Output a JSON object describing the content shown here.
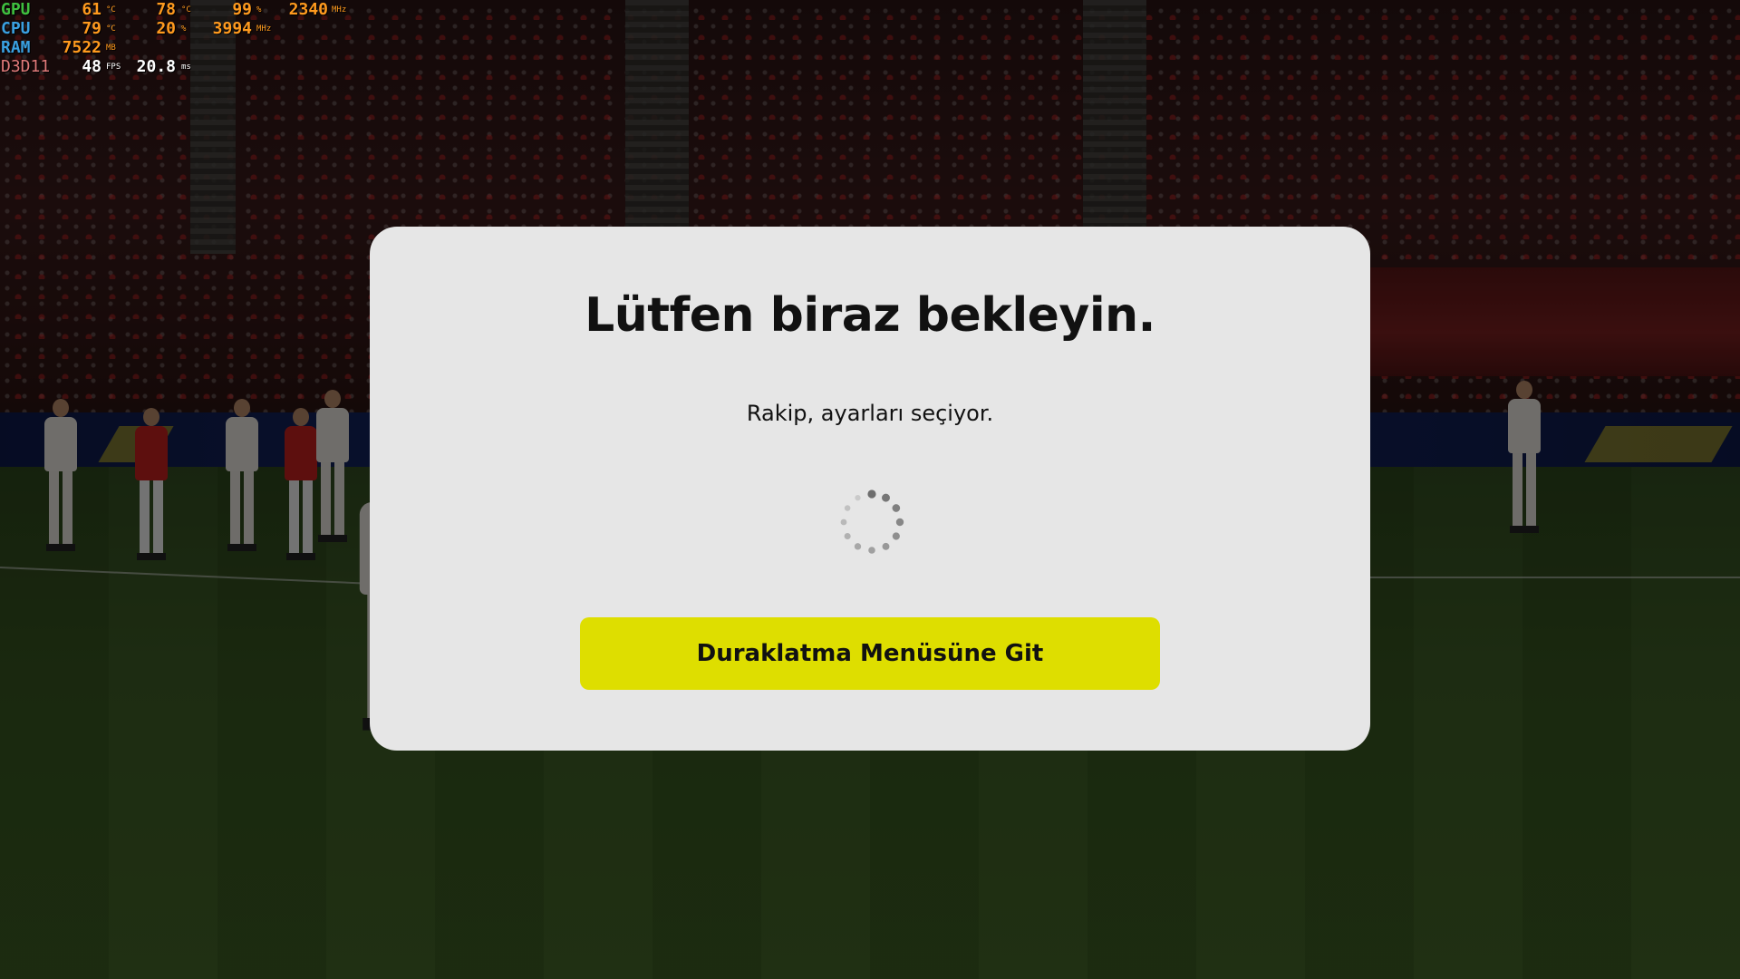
{
  "hardware_overlay": {
    "gpu": {
      "label": "GPU",
      "temp": "61",
      "temp_unit": "°C",
      "load": "78",
      "load_unit": "°C",
      "usage": "99",
      "usage_unit": "%",
      "clock": "2340",
      "clock_unit": "MHz",
      "label_color": "#3fbf3f"
    },
    "cpu": {
      "label": "CPU",
      "temp": "79",
      "temp_unit": "°C",
      "usage": "20",
      "usage_unit": "%",
      "clock": "3994",
      "clock_unit": "MHz",
      "label_color": "#3aa0e0"
    },
    "ram": {
      "label": "RAM",
      "used": "7522",
      "used_unit": "MB",
      "label_color": "#3aa0e0"
    },
    "d3d": {
      "label": "D3D11",
      "fps": "48",
      "fps_unit": "FPS",
      "frametime": "20.8",
      "frametime_unit": "ms",
      "label_color": "#e07a7a"
    }
  },
  "dialog": {
    "title": "Lütfen biraz bekleyin.",
    "message": "Rakip, ayarları seçiyor.",
    "spinner_icon": "loading-spinner-icon",
    "button_label": "Duraklatma Menüsüne Git",
    "button_color": "#dede00",
    "background_color": "#e6e6e6"
  }
}
